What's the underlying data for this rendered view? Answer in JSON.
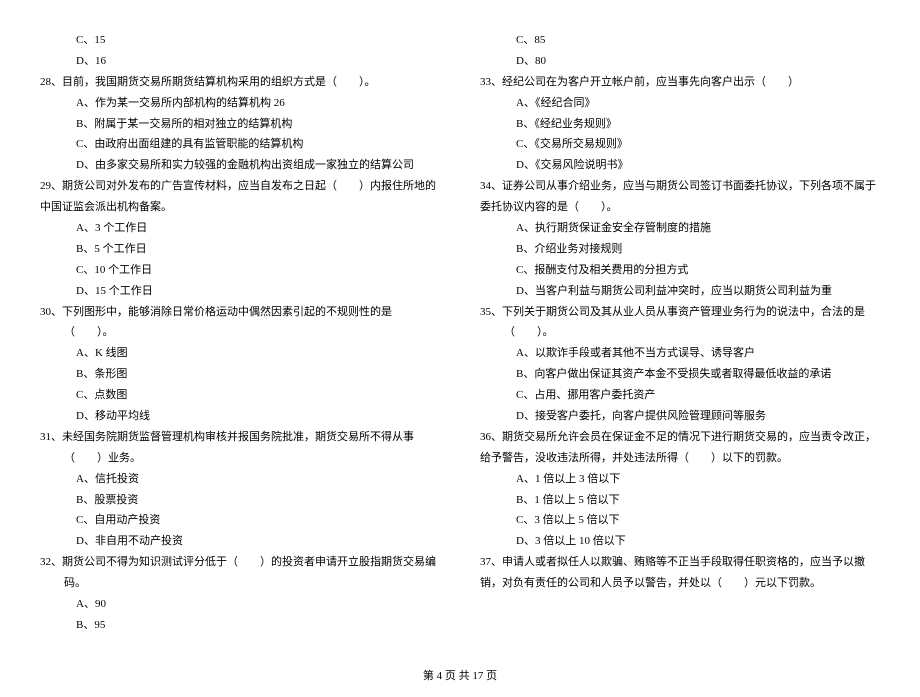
{
  "left": {
    "pre_opts": [
      "C、15",
      "D、16"
    ],
    "q28": "28、目前，我国期货交易所期货结算机构采用的组织方式是（　　）。",
    "q28_opts": [
      "A、作为某一交易所内部机构的结算机构 26",
      "B、附属于某一交易所的相对独立的结算机构",
      "C、由政府出面组建的具有监管职能的结算机构",
      "D、由多家交易所和实力较强的金融机构出资组成一家独立的结算公司"
    ],
    "q29": "29、期货公司对外发布的广告宣传材料，应当自发布之日起（　　）内报住所地的中国证监会派出机构备案。",
    "q29_opts": [
      "A、3 个工作日",
      "B、5 个工作日",
      "C、10 个工作日",
      "D、15 个工作日"
    ],
    "q30": "30、下列图形中，能够消除日常价格运动中偶然因素引起的不规则性的是（　　）。",
    "q30_opts": [
      "A、K 线图",
      "B、条形图",
      "C、点数图",
      "D、移动平均线"
    ],
    "q31": "31、未经国务院期货监督管理机构审核并报国务院批准，期货交易所不得从事（　　）业务。",
    "q31_opts": [
      "A、信托投资",
      "B、股票投资",
      "C、自用动产投资",
      "D、非自用不动产投资"
    ],
    "q32": "32、期货公司不得为知识测试评分低于（　　）的投资者申请开立股指期货交易编码。",
    "q32_opts": [
      "A、90",
      "B、95"
    ]
  },
  "right": {
    "pre_opts": [
      "C、85",
      "D、80"
    ],
    "q33": "33、经纪公司在为客户开立帐户前，应当事先向客户出示（　　）",
    "q33_opts": [
      "A、《经纪合同》",
      "B、《经纪业务规则》",
      "C、《交易所交易规则》",
      "D、《交易风险说明书》"
    ],
    "q34": "34、证券公司从事介绍业务，应当与期货公司签订书面委托协议，下列各项不属于委托协议内容的是（　　）。",
    "q34_opts": [
      "A、执行期货保证金安全存管制度的措施",
      "B、介绍业务对接规则",
      "C、报酬支付及相关费用的分担方式",
      "D、当客户利益与期货公司利益冲突时，应当以期货公司利益为重"
    ],
    "q35": "35、下列关于期货公司及其从业人员从事资产管理业务行为的说法中，合法的是（　　）。",
    "q35_opts": [
      "A、以欺诈手段或者其他不当方式误导、诱导客户",
      "B、向客户做出保证其资产本金不受损失或者取得最低收益的承诺",
      "C、占用、挪用客户委托资产",
      "D、接受客户委托，向客户提供风险管理顾问等服务"
    ],
    "q36": "36、期货交易所允许会员在保证金不足的情况下进行期货交易的，应当责令改正，给予警告，没收违法所得，并处违法所得（　　）以下的罚款。",
    "q36_opts": [
      "A、1 倍以上 3 倍以下",
      "B、1 倍以上 5 倍以下",
      "C、3 倍以上 5 倍以下",
      "D、3 倍以上 10 倍以下"
    ],
    "q37": "37、申请人或者拟任人以欺骗、贿赂等不正当手段取得任职资格的，应当予以撤销，对负有责任的公司和人员予以警告，并处以（　　）元以下罚款。"
  },
  "footer": "第 4 页 共 17 页"
}
